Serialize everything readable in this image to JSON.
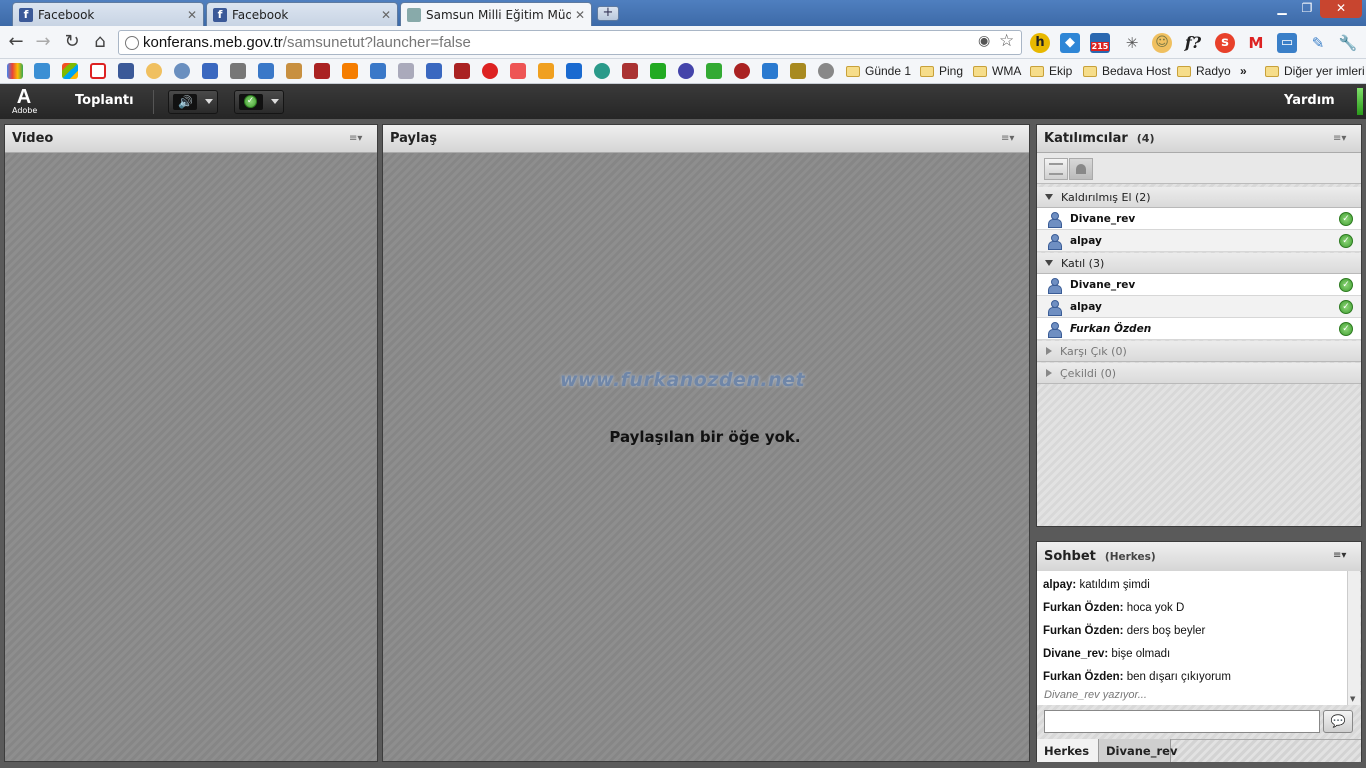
{
  "browser": {
    "tabs": [
      {
        "title": "Facebook",
        "favicon": "facebook-icon"
      },
      {
        "title": "Facebook",
        "favicon": "facebook-icon"
      },
      {
        "title": "Samsun Milli Eğitim Müdürlüğü",
        "favicon": "page-icon",
        "active": true
      }
    ],
    "url_host": "konferans.meb.gov.tr",
    "url_path": "/samsunetut?launcher=false",
    "extensions": [
      "lightbulb-icon",
      "star-icon",
      "h-icon",
      "dropbox-icon",
      "badge-215-icon",
      "bug-icon",
      "face-icon",
      "fquestion-icon",
      "stumbleupon-icon",
      "gmail-icon",
      "screen-icon",
      "pen-icon",
      "wrench-icon"
    ],
    "ext_badge": "215",
    "bookmark_folders": [
      "Günde 1",
      "Ping",
      "WMA",
      "Ekip",
      "Bedava Host",
      "Radyo"
    ],
    "overflow": "»",
    "other_bookmarks": "Diğer yer imleri"
  },
  "app": {
    "logo_text": "Adobe",
    "menu_meeting": "Toplantı",
    "menu_help": "Yardım"
  },
  "pods": {
    "video": {
      "title": "Video"
    },
    "share": {
      "title": "Paylaş",
      "watermark": "www.furkanozden.net",
      "empty_message": "Paylaşılan bir öğe yok."
    },
    "attendees": {
      "title": "Katılımcılar",
      "count": "(4)",
      "groups": [
        {
          "label": "Kaldırılmış El (2)",
          "expanded": true,
          "members": [
            {
              "name": "Divane_rev",
              "status": "agree"
            },
            {
              "name": "alpay",
              "status": "agree"
            }
          ]
        },
        {
          "label": "Katıl (3)",
          "expanded": true,
          "members": [
            {
              "name": "Divane_rev",
              "status": "agree"
            },
            {
              "name": "alpay",
              "status": "agree"
            },
            {
              "name": "Furkan Özden",
              "status": "agree",
              "italic": true
            }
          ]
        },
        {
          "label": "Karşı Çık (0)",
          "expanded": false
        },
        {
          "label": "Çekildi (0)",
          "expanded": false
        }
      ]
    },
    "chat": {
      "title": "Sohbet",
      "scope": "(Herkes)",
      "messages": [
        {
          "from": "alpay:",
          "text": "katıldım şimdi"
        },
        {
          "from": "Furkan Özden:",
          "text": "hoca yok D"
        },
        {
          "from": "Furkan Özden:",
          "text": "ders boş beyler"
        },
        {
          "from": "Divane_rev:",
          "text": "bişe olmadı"
        },
        {
          "from": "Furkan Özden:",
          "text": "ben dışarı çıkıyorum"
        }
      ],
      "typing": "Divane_rev yazıyor...",
      "input_value": "",
      "tabs": [
        "Herkes",
        "Divane_rev"
      ]
    }
  },
  "colors": {
    "status_green": "#3f9d2f",
    "app_bar": "#2e2e2e",
    "browser_frame": "#3d6aa8"
  }
}
